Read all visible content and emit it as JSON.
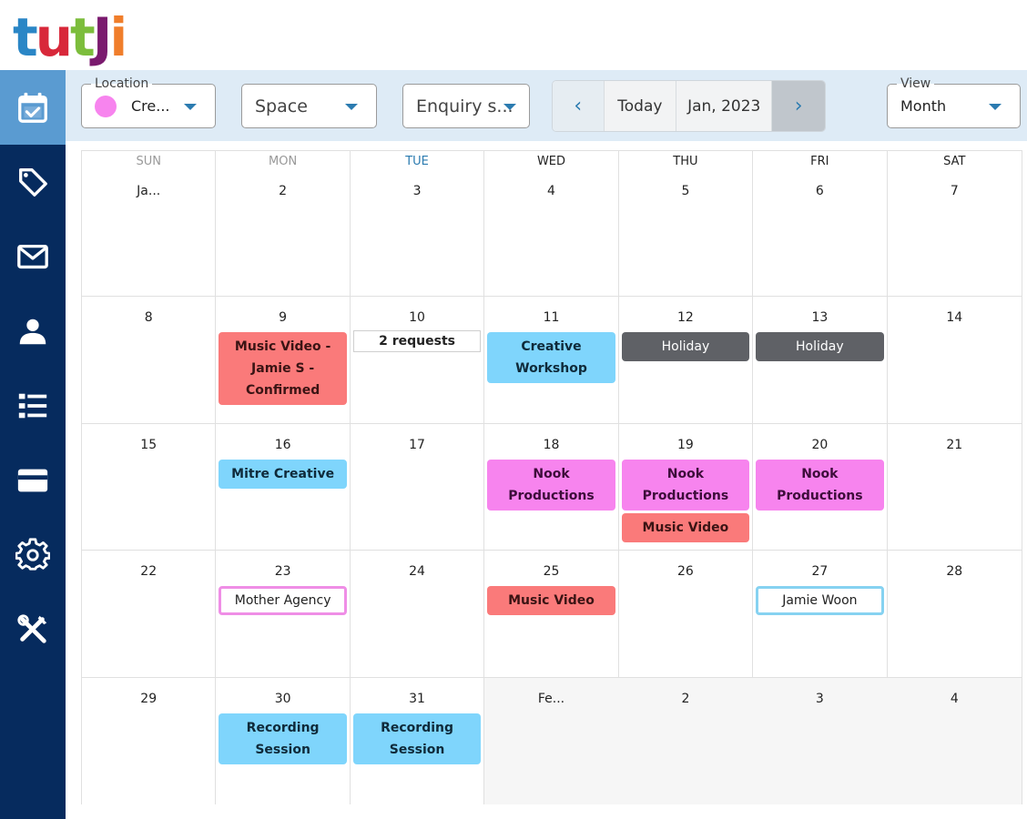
{
  "logo": {
    "letters": [
      {
        "char": "t",
        "color": "#2a86c6"
      },
      {
        "char": "u",
        "color": "#d8283a"
      },
      {
        "char": "t",
        "color": "#7cbd3c"
      },
      {
        "char": "J",
        "color": "#7a1a6e"
      },
      {
        "char": "i",
        "color": "#f07e2b"
      }
    ]
  },
  "sidebar": {
    "items": [
      {
        "name": "calendar",
        "icon": "calendar-check-icon",
        "active": true
      },
      {
        "name": "tags",
        "icon": "tag-icon",
        "active": false
      },
      {
        "name": "messages",
        "icon": "mail-icon",
        "active": false
      },
      {
        "name": "contacts",
        "icon": "user-icon",
        "active": false
      },
      {
        "name": "list",
        "icon": "list-icon",
        "active": false
      },
      {
        "name": "payments",
        "icon": "credit-card-icon",
        "active": false
      },
      {
        "name": "settings",
        "icon": "gear-icon",
        "active": false
      },
      {
        "name": "tools",
        "icon": "tools-icon",
        "active": false
      }
    ]
  },
  "toolbar": {
    "location": {
      "legend": "Location",
      "value": "Cre...",
      "dot_color": "#f784ee"
    },
    "space": {
      "placeholder": "Space"
    },
    "enquiry": {
      "placeholder": "Enquiry s..."
    },
    "nav": {
      "prev": "‹",
      "today": "Today",
      "current": "Jan, 2023",
      "next": "›"
    },
    "view": {
      "legend": "View",
      "value": "Month"
    }
  },
  "calendar": {
    "weekdays": [
      "SUN",
      "MON",
      "TUE",
      "WED",
      "THU",
      "FRI",
      "SAT"
    ],
    "today_weekday": "TUE",
    "weeks": [
      [
        {
          "label": "Ja...",
          "events": []
        },
        {
          "label": "2",
          "events": []
        },
        {
          "label": "3",
          "events": []
        },
        {
          "label": "4",
          "events": []
        },
        {
          "label": "5",
          "events": []
        },
        {
          "label": "6",
          "events": []
        },
        {
          "label": "7",
          "events": []
        }
      ],
      [
        {
          "label": "8",
          "events": []
        },
        {
          "label": "9",
          "events": [
            {
              "title": "Music Video - Jamie S - Confirmed",
              "style": "red"
            }
          ]
        },
        {
          "label": "10",
          "events": [
            {
              "title": "2 requests",
              "style": "requests"
            }
          ]
        },
        {
          "label": "11",
          "events": [
            {
              "title": "Creative Workshop",
              "style": "blue"
            }
          ]
        },
        {
          "label": "12",
          "events": [
            {
              "title": "Holiday",
              "style": "grey"
            }
          ]
        },
        {
          "label": "13",
          "events": [
            {
              "title": "Holiday",
              "style": "grey"
            }
          ]
        },
        {
          "label": "14",
          "events": []
        }
      ],
      [
        {
          "label": "15",
          "events": []
        },
        {
          "label": "16",
          "events": [
            {
              "title": "Mitre Creative",
              "style": "blue"
            }
          ]
        },
        {
          "label": "17",
          "events": []
        },
        {
          "label": "18",
          "events": [
            {
              "title": "Nook Productions",
              "style": "pink"
            }
          ]
        },
        {
          "label": "19",
          "events": [
            {
              "title": "Nook Productions",
              "style": "pink"
            },
            {
              "title": "Music Video",
              "style": "red"
            }
          ]
        },
        {
          "label": "20",
          "events": [
            {
              "title": "Nook Productions",
              "style": "pink"
            }
          ]
        },
        {
          "label": "21",
          "events": []
        }
      ],
      [
        {
          "label": "22",
          "events": []
        },
        {
          "label": "23",
          "events": [
            {
              "title": "Mother Agency",
              "style": "out-pink"
            }
          ]
        },
        {
          "label": "24",
          "events": []
        },
        {
          "label": "25",
          "events": [
            {
              "title": "Music Video",
              "style": "red"
            }
          ]
        },
        {
          "label": "26",
          "events": []
        },
        {
          "label": "27",
          "events": [
            {
              "title": "Jamie Woon",
              "style": "out-blue"
            }
          ]
        },
        {
          "label": "28",
          "events": []
        }
      ],
      [
        {
          "label": "29",
          "events": []
        },
        {
          "label": "30",
          "events": [
            {
              "title": "Recording Session",
              "style": "blue"
            }
          ]
        },
        {
          "label": "31",
          "events": [
            {
              "title": "Recording Session",
              "style": "blue"
            }
          ]
        },
        {
          "label": "Fe...",
          "events": [],
          "other_month": true
        },
        {
          "label": "2",
          "events": [],
          "other_month": true
        },
        {
          "label": "3",
          "events": [],
          "other_month": true
        },
        {
          "label": "4",
          "events": [],
          "other_month": true
        }
      ]
    ]
  },
  "colors": {
    "sidebar_bg": "#062b5e",
    "sidebar_active": "#5a9bd1",
    "toolbar_bg": "#deebf6",
    "accent": "#2b7bb0",
    "event_red": "#fa7a7a",
    "event_blue": "#7fd5fc",
    "event_pink": "#f784ee",
    "event_grey": "#5f6166"
  }
}
